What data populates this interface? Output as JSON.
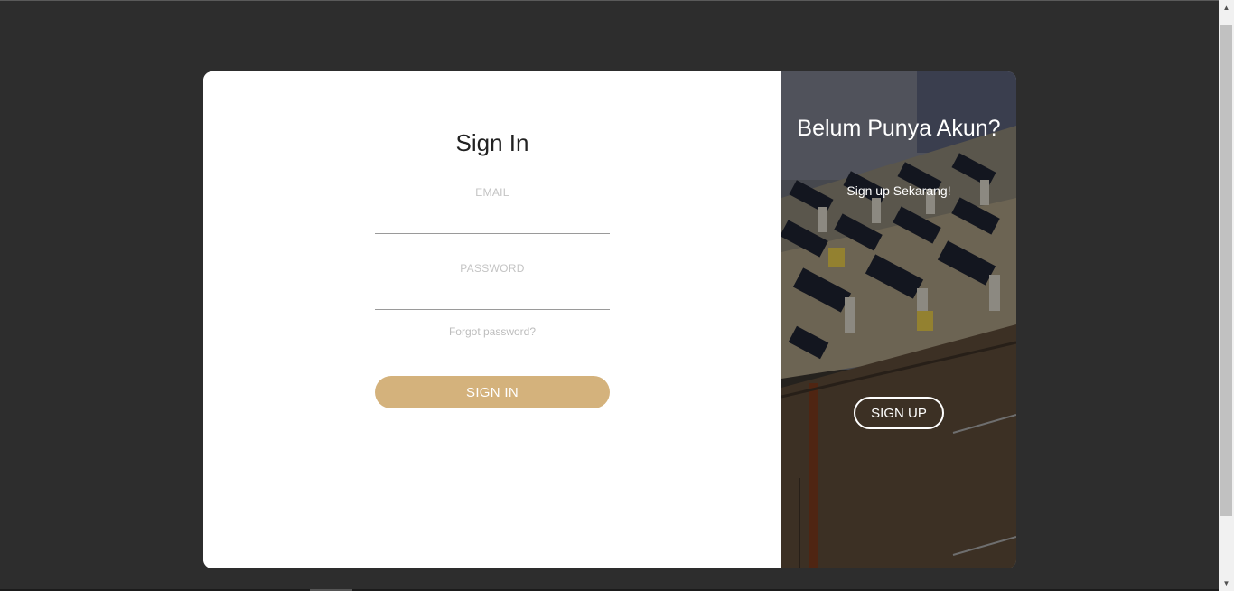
{
  "signin": {
    "title": "Sign In",
    "email_label": "EMAIL",
    "email_value": "",
    "password_label": "PASSWORD",
    "password_value": "",
    "forgot_link": "Forgot password?",
    "button_label": "SIGN IN"
  },
  "signup": {
    "title": "Belum Punya Akun?",
    "subtitle": "Sign up Sekarang!",
    "button_label": "SIGN UP"
  },
  "colors": {
    "page_background": "#2d2d2d",
    "accent": "#d4b27c",
    "card_background": "#ffffff"
  }
}
